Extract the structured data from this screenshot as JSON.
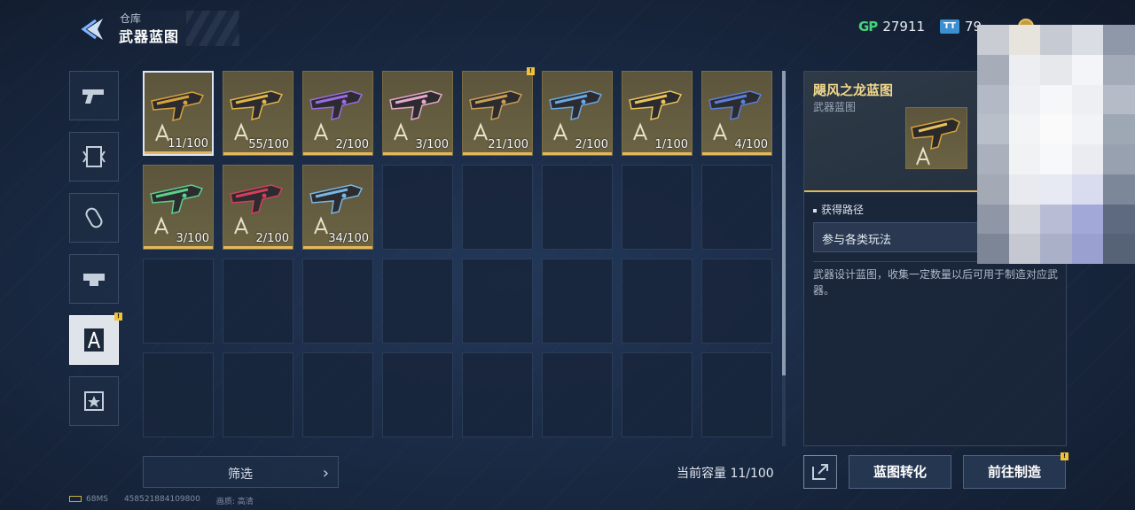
{
  "header": {
    "subtitle": "仓库",
    "title": "武器蓝图"
  },
  "currencies": [
    {
      "icon": "gp-icon",
      "label": "GP",
      "value": "27911"
    },
    {
      "icon": "ticket-icon",
      "label": "TT",
      "value": "79..."
    }
  ],
  "sidebar": {
    "items": [
      {
        "name": "sidebar-item-weapons",
        "icon": "pistol-icon"
      },
      {
        "name": "sidebar-item-cards",
        "icon": "card-icon"
      },
      {
        "name": "sidebar-item-consumables",
        "icon": "capsule-icon"
      },
      {
        "name": "sidebar-item-vehicles",
        "icon": "armor-icon"
      },
      {
        "name": "sidebar-item-blueprints",
        "icon": "compass-icon",
        "active": true,
        "badge": "!"
      },
      {
        "name": "sidebar-item-badges",
        "icon": "star-badge-icon"
      }
    ]
  },
  "grid": {
    "items": [
      {
        "count": "11/100",
        "color": "#d6a13a",
        "selected": true
      },
      {
        "count": "55/100",
        "color": "#e0b448"
      },
      {
        "count": "2/100",
        "color": "#9b6be0"
      },
      {
        "count": "3/100",
        "color": "#e6a8c8"
      },
      {
        "count": "21/100",
        "color": "#c99d55",
        "badge": "!"
      },
      {
        "count": "2/100",
        "color": "#6aa8e0"
      },
      {
        "count": "1/100",
        "color": "#e8c25a"
      },
      {
        "count": "4/100",
        "color": "#5b7fd6"
      },
      {
        "count": "3/100",
        "color": "#5ccf8a"
      },
      {
        "count": "2/100",
        "color": "#d0405a"
      },
      {
        "count": "34/100",
        "color": "#7ab6e0"
      }
    ]
  },
  "filter": {
    "label": "筛选"
  },
  "capacity": {
    "text": "当前容量 11/100"
  },
  "detail": {
    "name": "飓风之龙蓝图",
    "type": "武器蓝图",
    "source_title": "获得路径",
    "source": "参与各类玩法",
    "description": "武器设计蓝图，收集一定数量以后可用于制造对应武器。"
  },
  "actions": {
    "convert": "蓝图转化",
    "craft": "前往制造",
    "craft_badge": "!"
  },
  "footer": {
    "ping": "68MS",
    "id": "458521884109800",
    "quality_label": "画质:",
    "quality": "高清"
  }
}
